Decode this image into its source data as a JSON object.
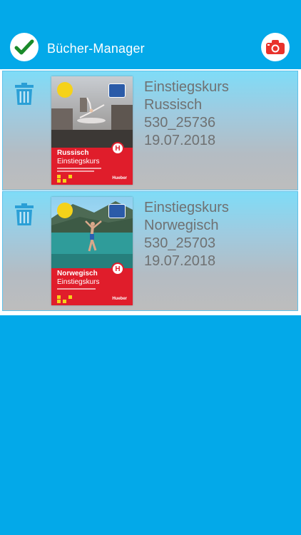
{
  "header": {
    "title": "Bücher-Manager",
    "done_icon": "checkmark-icon",
    "camera_icon": "camera-icon"
  },
  "books": [
    {
      "line1": "Einstiegskurs",
      "line2": "Russisch",
      "code": "530_25736",
      "date": "19.07.2018",
      "cover": {
        "lang": "Russisch",
        "sub": "Einstiegskurs",
        "publisher": "Hueber",
        "h": "H"
      }
    },
    {
      "line1": "Einstiegskurs",
      "line2": "Norwegisch",
      "code": "530_25703",
      "date": "19.07.2018",
      "cover": {
        "lang": "Norwegisch",
        "sub": "Einstiegskurs",
        "publisher": "Hueber",
        "h": "H"
      }
    }
  ],
  "colors": {
    "brand_blue": "#03a9e9",
    "check_green": "#1a8a2a",
    "camera_red": "#e8322c",
    "trash_blue": "#2a9fd6"
  }
}
